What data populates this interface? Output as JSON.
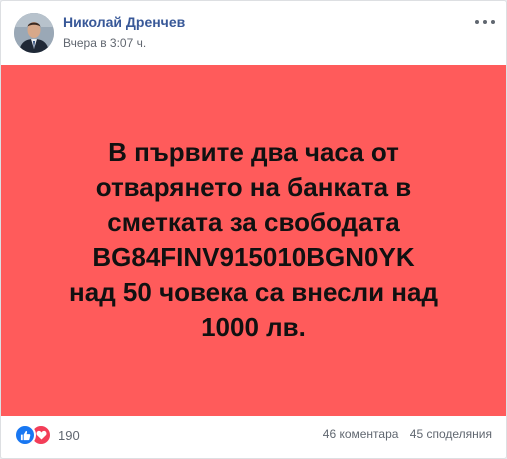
{
  "post": {
    "author": "Николай Дренчев",
    "time": "Вчера в 3:07 ч.",
    "image": {
      "background_color": "#ff5b5b",
      "text_lines": [
        "В първите два часа от",
        "отварянето на банката в",
        "сметката за свободата",
        "BG84FINV915010BGN0YK",
        "над 50 човека са внесли над",
        "1000 лв."
      ]
    }
  },
  "footer": {
    "reactions": {
      "icons": [
        "like-icon",
        "love-icon"
      ],
      "count": "190"
    },
    "comments": "46 коментара",
    "shares": "45 споделяния"
  },
  "colors": {
    "author_link": "#385898",
    "like": "#1877f2",
    "love": "#f33e58"
  }
}
